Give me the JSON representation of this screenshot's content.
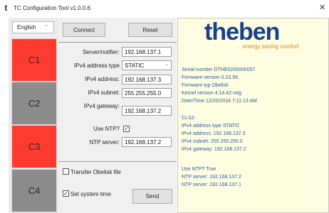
{
  "window": {
    "app_icon": "t",
    "title": "TC Configuration Tool v1.0.0.6",
    "close_glyph": "✕"
  },
  "sidebar": {
    "language": "English",
    "channels": [
      {
        "label": "C1",
        "state": "red"
      },
      {
        "label": "C2",
        "state": "grey"
      },
      {
        "label": "C3",
        "state": "red"
      },
      {
        "label": "C4",
        "state": "grey"
      }
    ]
  },
  "toolbar": {
    "connect_label": "Connect",
    "reset_label": "Reset"
  },
  "form": {
    "server_label": "Server/notifier:",
    "server_value": "192.168.137.1",
    "addr_type_label": "IPv4 address type",
    "addr_type_value": "STATIC",
    "ipv4_label": "IPv4 address:",
    "ipv4_value": "192.168.137.3",
    "subnet_label": "IPv4 subnet:",
    "subnet_value": "255.255.255.0",
    "gateway_label": "IPv4 gateway:",
    "gateway_value": "192.168.137.2",
    "ntp_use_label": "Use NTP?",
    "ntp_use_checked": true,
    "ntp_server_label": "NTP server:",
    "ntp_server_value": "192.168.137.2"
  },
  "transfer": {
    "obelisk_label": "Transfer Obelisk file",
    "obelisk_checked": false,
    "systime_label": "Set system time",
    "systime_checked": true,
    "send_label": "Send"
  },
  "brand": {
    "logo": "theben",
    "tagline": "energy saving comfort",
    "primary_color": "#1b3f8f",
    "accent_color": "#e08a1e"
  },
  "info": {
    "lines": [
      "Serial number DTHE0200000007",
      "Firmware version 0.23.56",
      "Firmware typ Obelisk",
      "Kernel version 4.14.42-mtg",
      "Date/Time 12/20/2018 7:11:13 AM",
      "CLS2:",
      "IPv4 address type STATIC",
      "IPv4 address: 192.168.137.3",
      "IPv4 subnet: 255.255.255.0",
      "IPv4 gateway: 192.168.137.2",
      "Use NTP? True",
      "NTP server: 192.168.137.2",
      "NTP server: 192.168.137.1"
    ]
  }
}
